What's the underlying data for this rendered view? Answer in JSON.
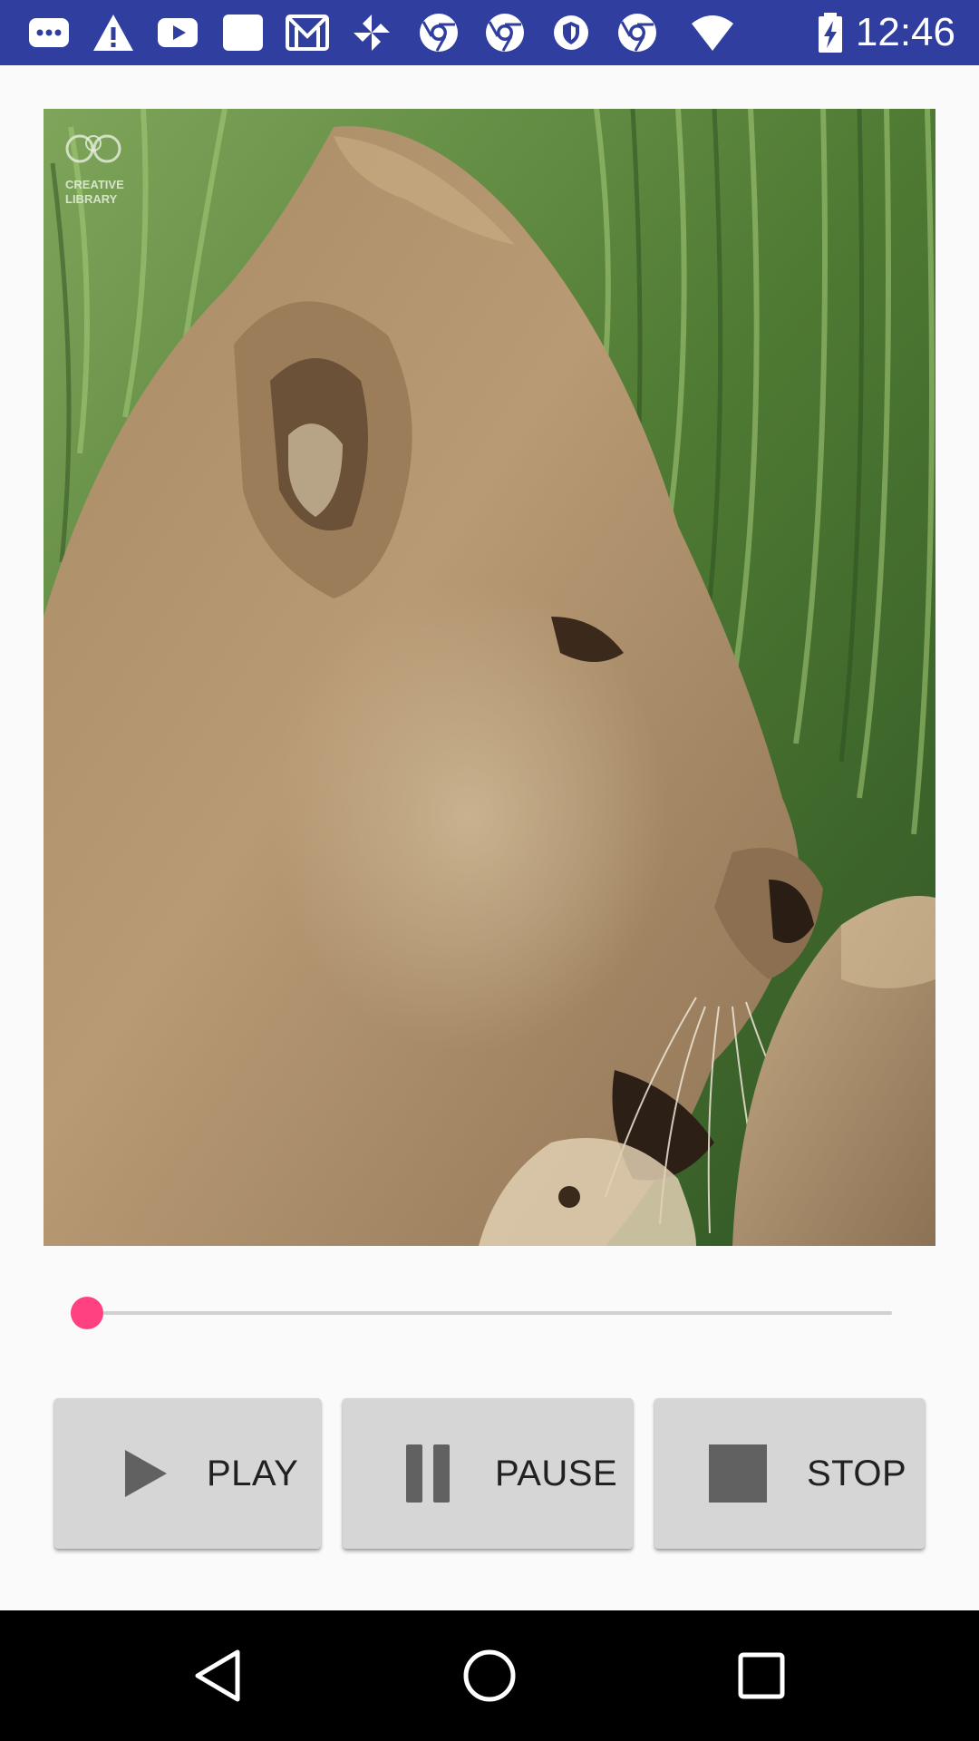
{
  "status_bar": {
    "time": "12:46",
    "background": "#303f9f",
    "icons": [
      "chat-icon",
      "warning-icon",
      "youtube-icon",
      "card-icon",
      "gmail-icon",
      "pinwheel-icon",
      "chrome-icon",
      "chrome-icon",
      "shield-icon",
      "chrome-icon",
      "wifi-icon",
      "battery-charging-icon"
    ]
  },
  "video": {
    "watermark_text": "CREATIVE LIBRARY",
    "content": "lioness-close-up"
  },
  "seek_bar": {
    "progress": 0.0,
    "accent": "#ff4081"
  },
  "controls": {
    "play": {
      "label": "PLAY",
      "icon": "play-icon"
    },
    "pause": {
      "label": "PAUSE",
      "icon": "pause-icon"
    },
    "stop": {
      "label": "STOP",
      "icon": "stop-icon"
    }
  },
  "nav_bar": {
    "back_icon": "back-icon",
    "home_icon": "home-icon",
    "recents_icon": "recents-icon"
  }
}
